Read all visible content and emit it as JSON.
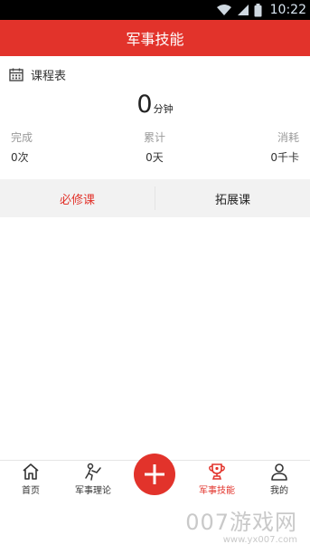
{
  "status_bar": {
    "time": "10:22"
  },
  "header": {
    "title": "军事技能"
  },
  "schedule": {
    "label": "课程表",
    "icon": "calendar-icon"
  },
  "total": {
    "value": "0",
    "unit": "分钟"
  },
  "stats": [
    {
      "label": "完成",
      "value": "0次"
    },
    {
      "label": "累计",
      "value": "0天"
    },
    {
      "label": "消耗",
      "value": "0千卡"
    }
  ],
  "course_tabs": [
    {
      "label": "必修课",
      "active": true
    },
    {
      "label": "拓展课",
      "active": false
    }
  ],
  "bottom_nav": {
    "items": [
      {
        "label": "首页",
        "icon": "home-icon"
      },
      {
        "label": "军事理论",
        "icon": "theory-icon"
      },
      {
        "label": "军事技能",
        "icon": "trophy-icon",
        "active": true
      },
      {
        "label": "我的",
        "icon": "user-icon"
      }
    ],
    "fab_icon": "plus-icon"
  },
  "watermark": {
    "big": "007游戏网",
    "small": "www.yx007.com"
  },
  "colors": {
    "accent": "#e2332b",
    "tab_bg": "#f2f2f2"
  }
}
